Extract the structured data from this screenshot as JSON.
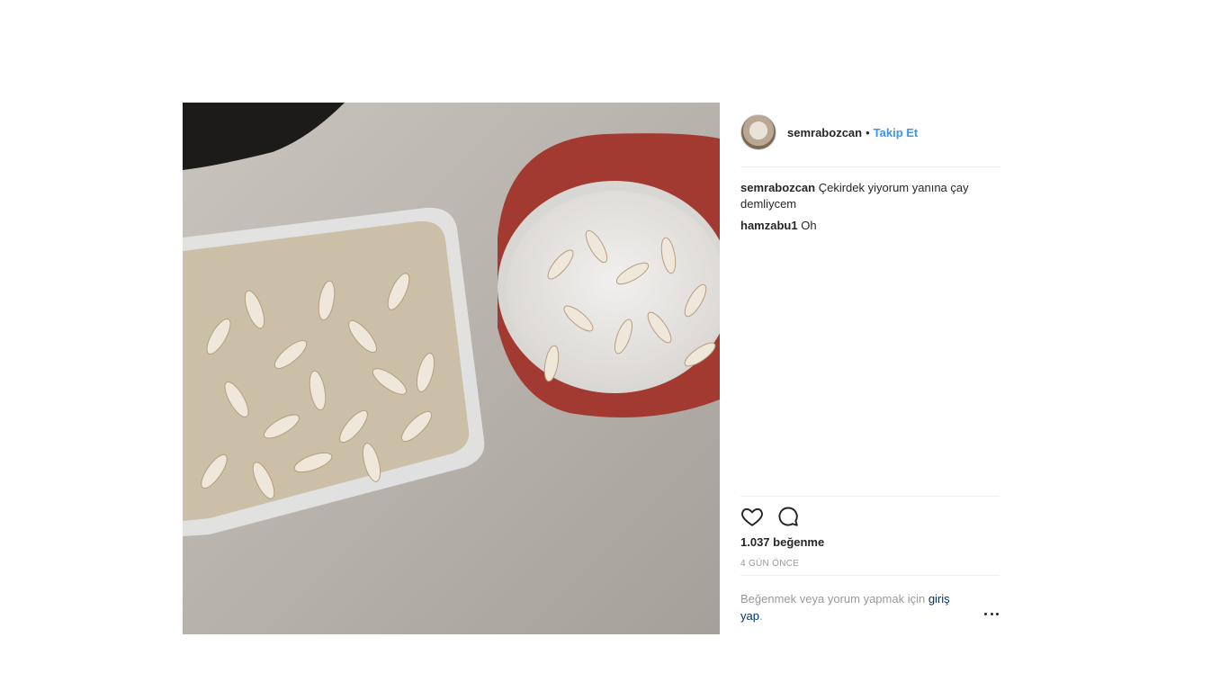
{
  "post": {
    "image_icon": "post-photo",
    "author": {
      "username": "semrabozcan",
      "separator": "•",
      "follow_label": "Takip Et",
      "avatar_icon": "avatar"
    },
    "comments": [
      {
        "user": "semrabozcan",
        "text": "Çekirdek yiyorum yanına çay demliycem"
      },
      {
        "user": "hamzabu1",
        "text": "Oh"
      }
    ],
    "actions": {
      "like_icon": "heart-icon",
      "comment_icon": "comment-icon"
    },
    "likes": "1.037 beğenme",
    "time": "4 GÜN ÖNCE",
    "login_prompt": {
      "prefix": "Beğenmek veya yorum yapmak için ",
      "link": "giriş yap",
      "suffix": "."
    },
    "more_icon": "more-options-icon"
  },
  "colors": {
    "link": "#3897f0",
    "login_link": "#003569",
    "muted": "#999999",
    "text": "#262626",
    "border": "#efefef"
  }
}
